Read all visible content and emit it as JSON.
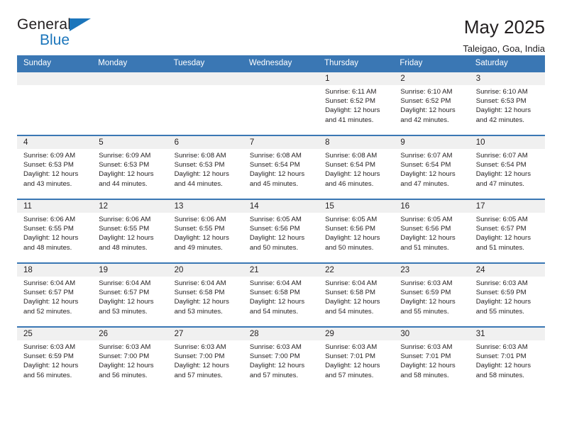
{
  "brand": {
    "name_top": "General",
    "name_bottom": "Blue",
    "accent_color": "#1b75bb"
  },
  "header": {
    "title": "May 2025",
    "subtitle": "Taleigao, Goa, India"
  },
  "theme": {
    "header_row_bg": "#3a77b4",
    "daynum_bg": "#f0f0f0",
    "text_color": "#231f20"
  },
  "weekday_headers": [
    "Sunday",
    "Monday",
    "Tuesday",
    "Wednesday",
    "Thursday",
    "Friday",
    "Saturday"
  ],
  "weeks": [
    [
      {
        "date": "",
        "empty": true
      },
      {
        "date": "",
        "empty": true
      },
      {
        "date": "",
        "empty": true
      },
      {
        "date": "",
        "empty": true
      },
      {
        "date": "1",
        "sunrise": "Sunrise: 6:11 AM",
        "sunset": "Sunset: 6:52 PM",
        "daylight1": "Daylight: 12 hours",
        "daylight2": "and 41 minutes."
      },
      {
        "date": "2",
        "sunrise": "Sunrise: 6:10 AM",
        "sunset": "Sunset: 6:52 PM",
        "daylight1": "Daylight: 12 hours",
        "daylight2": "and 42 minutes."
      },
      {
        "date": "3",
        "sunrise": "Sunrise: 6:10 AM",
        "sunset": "Sunset: 6:53 PM",
        "daylight1": "Daylight: 12 hours",
        "daylight2": "and 42 minutes."
      }
    ],
    [
      {
        "date": "4",
        "sunrise": "Sunrise: 6:09 AM",
        "sunset": "Sunset: 6:53 PM",
        "daylight1": "Daylight: 12 hours",
        "daylight2": "and 43 minutes."
      },
      {
        "date": "5",
        "sunrise": "Sunrise: 6:09 AM",
        "sunset": "Sunset: 6:53 PM",
        "daylight1": "Daylight: 12 hours",
        "daylight2": "and 44 minutes."
      },
      {
        "date": "6",
        "sunrise": "Sunrise: 6:08 AM",
        "sunset": "Sunset: 6:53 PM",
        "daylight1": "Daylight: 12 hours",
        "daylight2": "and 44 minutes."
      },
      {
        "date": "7",
        "sunrise": "Sunrise: 6:08 AM",
        "sunset": "Sunset: 6:54 PM",
        "daylight1": "Daylight: 12 hours",
        "daylight2": "and 45 minutes."
      },
      {
        "date": "8",
        "sunrise": "Sunrise: 6:08 AM",
        "sunset": "Sunset: 6:54 PM",
        "daylight1": "Daylight: 12 hours",
        "daylight2": "and 46 minutes."
      },
      {
        "date": "9",
        "sunrise": "Sunrise: 6:07 AM",
        "sunset": "Sunset: 6:54 PM",
        "daylight1": "Daylight: 12 hours",
        "daylight2": "and 47 minutes."
      },
      {
        "date": "10",
        "sunrise": "Sunrise: 6:07 AM",
        "sunset": "Sunset: 6:54 PM",
        "daylight1": "Daylight: 12 hours",
        "daylight2": "and 47 minutes."
      }
    ],
    [
      {
        "date": "11",
        "sunrise": "Sunrise: 6:06 AM",
        "sunset": "Sunset: 6:55 PM",
        "daylight1": "Daylight: 12 hours",
        "daylight2": "and 48 minutes."
      },
      {
        "date": "12",
        "sunrise": "Sunrise: 6:06 AM",
        "sunset": "Sunset: 6:55 PM",
        "daylight1": "Daylight: 12 hours",
        "daylight2": "and 48 minutes."
      },
      {
        "date": "13",
        "sunrise": "Sunrise: 6:06 AM",
        "sunset": "Sunset: 6:55 PM",
        "daylight1": "Daylight: 12 hours",
        "daylight2": "and 49 minutes."
      },
      {
        "date": "14",
        "sunrise": "Sunrise: 6:05 AM",
        "sunset": "Sunset: 6:56 PM",
        "daylight1": "Daylight: 12 hours",
        "daylight2": "and 50 minutes."
      },
      {
        "date": "15",
        "sunrise": "Sunrise: 6:05 AM",
        "sunset": "Sunset: 6:56 PM",
        "daylight1": "Daylight: 12 hours",
        "daylight2": "and 50 minutes."
      },
      {
        "date": "16",
        "sunrise": "Sunrise: 6:05 AM",
        "sunset": "Sunset: 6:56 PM",
        "daylight1": "Daylight: 12 hours",
        "daylight2": "and 51 minutes."
      },
      {
        "date": "17",
        "sunrise": "Sunrise: 6:05 AM",
        "sunset": "Sunset: 6:57 PM",
        "daylight1": "Daylight: 12 hours",
        "daylight2": "and 51 minutes."
      }
    ],
    [
      {
        "date": "18",
        "sunrise": "Sunrise: 6:04 AM",
        "sunset": "Sunset: 6:57 PM",
        "daylight1": "Daylight: 12 hours",
        "daylight2": "and 52 minutes."
      },
      {
        "date": "19",
        "sunrise": "Sunrise: 6:04 AM",
        "sunset": "Sunset: 6:57 PM",
        "daylight1": "Daylight: 12 hours",
        "daylight2": "and 53 minutes."
      },
      {
        "date": "20",
        "sunrise": "Sunrise: 6:04 AM",
        "sunset": "Sunset: 6:58 PM",
        "daylight1": "Daylight: 12 hours",
        "daylight2": "and 53 minutes."
      },
      {
        "date": "21",
        "sunrise": "Sunrise: 6:04 AM",
        "sunset": "Sunset: 6:58 PM",
        "daylight1": "Daylight: 12 hours",
        "daylight2": "and 54 minutes."
      },
      {
        "date": "22",
        "sunrise": "Sunrise: 6:04 AM",
        "sunset": "Sunset: 6:58 PM",
        "daylight1": "Daylight: 12 hours",
        "daylight2": "and 54 minutes."
      },
      {
        "date": "23",
        "sunrise": "Sunrise: 6:03 AM",
        "sunset": "Sunset: 6:59 PM",
        "daylight1": "Daylight: 12 hours",
        "daylight2": "and 55 minutes."
      },
      {
        "date": "24",
        "sunrise": "Sunrise: 6:03 AM",
        "sunset": "Sunset: 6:59 PM",
        "daylight1": "Daylight: 12 hours",
        "daylight2": "and 55 minutes."
      }
    ],
    [
      {
        "date": "25",
        "sunrise": "Sunrise: 6:03 AM",
        "sunset": "Sunset: 6:59 PM",
        "daylight1": "Daylight: 12 hours",
        "daylight2": "and 56 minutes."
      },
      {
        "date": "26",
        "sunrise": "Sunrise: 6:03 AM",
        "sunset": "Sunset: 7:00 PM",
        "daylight1": "Daylight: 12 hours",
        "daylight2": "and 56 minutes."
      },
      {
        "date": "27",
        "sunrise": "Sunrise: 6:03 AM",
        "sunset": "Sunset: 7:00 PM",
        "daylight1": "Daylight: 12 hours",
        "daylight2": "and 57 minutes."
      },
      {
        "date": "28",
        "sunrise": "Sunrise: 6:03 AM",
        "sunset": "Sunset: 7:00 PM",
        "daylight1": "Daylight: 12 hours",
        "daylight2": "and 57 minutes."
      },
      {
        "date": "29",
        "sunrise": "Sunrise: 6:03 AM",
        "sunset": "Sunset: 7:01 PM",
        "daylight1": "Daylight: 12 hours",
        "daylight2": "and 57 minutes."
      },
      {
        "date": "30",
        "sunrise": "Sunrise: 6:03 AM",
        "sunset": "Sunset: 7:01 PM",
        "daylight1": "Daylight: 12 hours",
        "daylight2": "and 58 minutes."
      },
      {
        "date": "31",
        "sunrise": "Sunrise: 6:03 AM",
        "sunset": "Sunset: 7:01 PM",
        "daylight1": "Daylight: 12 hours",
        "daylight2": "and 58 minutes."
      }
    ]
  ]
}
